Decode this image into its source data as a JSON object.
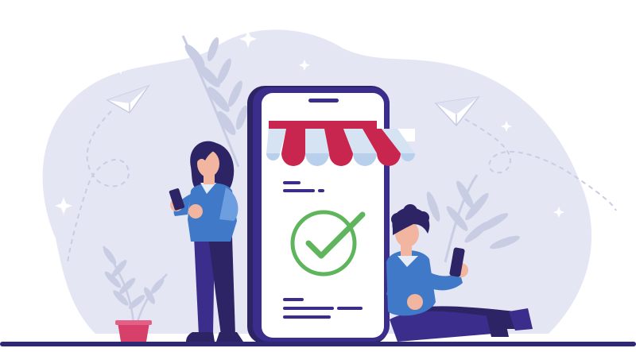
{
  "illustration": {
    "subject": "online-store-purchase-confirmed",
    "icons": [
      "paper-plane-icon",
      "sparkle-icon",
      "storefront-awning-icon",
      "checkmark-icon",
      "smartphone-icon",
      "plant-icon",
      "flower-pot-icon"
    ],
    "colors": {
      "background_blob": "#e4e6f3",
      "phone_frame": "#3a2d8c",
      "phone_screen": "#ffffff",
      "awning_red": "#c9264f",
      "awning_blue": "#b9d0ec",
      "check_green": "#5fb55b",
      "person_shirt": "#3f79c8",
      "person_pants": "#3a2d8c",
      "skin": "#f1b5a0",
      "hair": "#2d2465",
      "leaf": "#c9cde4",
      "pot": "#d8406c",
      "ground": "#2f2872"
    }
  }
}
